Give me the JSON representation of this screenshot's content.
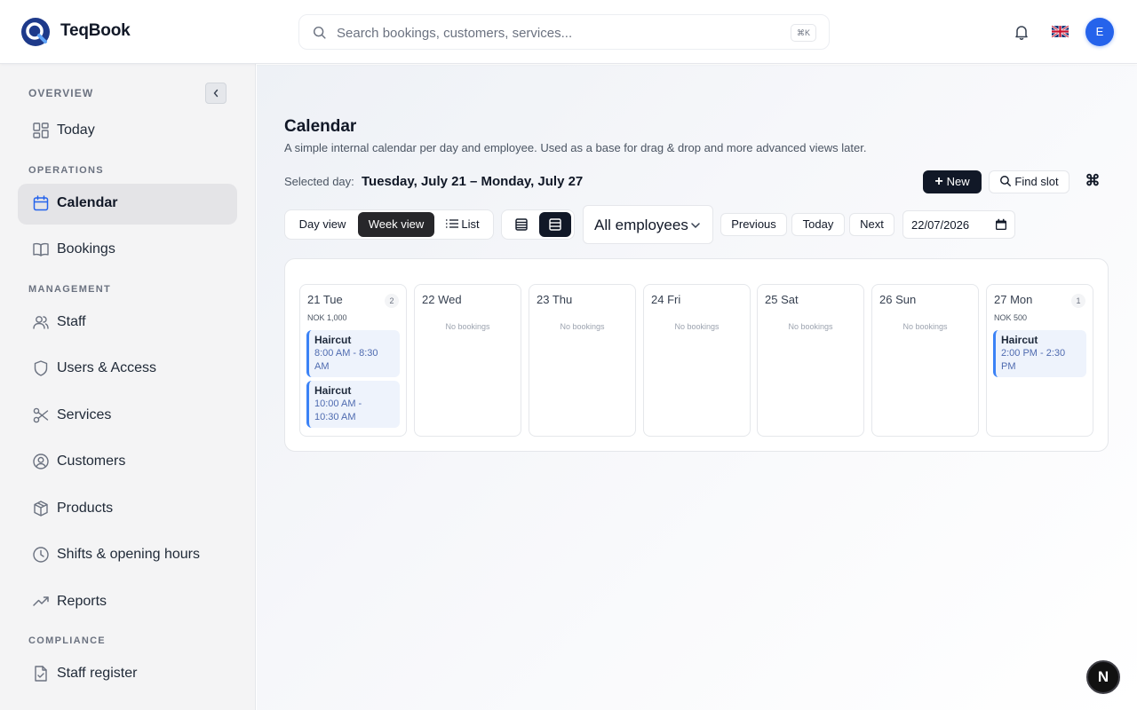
{
  "app": {
    "name": "TeqBook",
    "user_initial": "E"
  },
  "header": {
    "search_placeholder": "Search bookings, customers, services...",
    "search_shortcut": "⌘K"
  },
  "sidebar": {
    "sections": {
      "overview": "OVERVIEW",
      "operations": "OPERATIONS",
      "management": "MANAGEMENT",
      "compliance": "COMPLIANCE"
    },
    "items": [
      {
        "label": "Today",
        "icon": "grid-icon"
      },
      {
        "label": "Calendar",
        "icon": "calendar-icon",
        "active": true
      },
      {
        "label": "Bookings",
        "icon": "book-icon"
      },
      {
        "label": "Staff",
        "icon": "users-icon"
      },
      {
        "label": "Users & Access",
        "icon": "shield-icon"
      },
      {
        "label": "Services",
        "icon": "scissors-icon"
      },
      {
        "label": "Customers",
        "icon": "user-circle-icon"
      },
      {
        "label": "Products",
        "icon": "box-icon"
      },
      {
        "label": "Shifts & opening hours",
        "icon": "clock-icon"
      },
      {
        "label": "Reports",
        "icon": "trend-icon"
      },
      {
        "label": "Staff register",
        "icon": "file-check-icon"
      }
    ]
  },
  "main": {
    "title": "Calendar",
    "subtitle": "A simple internal calendar per day and employee. Used as a base for drag & drop and more advanced views later.",
    "selected_label": "Selected day:",
    "selected_value": "Tuesday, July 21 – Monday, July 27",
    "new_label": "New",
    "find_slot_label": "Find slot",
    "views": {
      "day": "Day view",
      "week": "Week view",
      "list": "List"
    },
    "employee_filter": "All employees",
    "nav": {
      "previous": "Previous",
      "today": "Today",
      "next": "Next"
    },
    "date_value": "22/07/2026",
    "empty_text": "No bookings",
    "days": [
      {
        "label": "21 Tue",
        "count": "2",
        "total": "NOK 1,000",
        "bookings": [
          {
            "title": "Haircut",
            "line1": "8:00 AM - 8:30",
            "line2": "AM"
          },
          {
            "title": "Haircut",
            "line1": "10:00 AM -",
            "line2": "10:30 AM"
          }
        ]
      },
      {
        "label": "22 Wed"
      },
      {
        "label": "23 Thu"
      },
      {
        "label": "24 Fri"
      },
      {
        "label": "25 Sat"
      },
      {
        "label": "26 Sun"
      },
      {
        "label": "27 Mon",
        "count": "1",
        "total": "NOK 500",
        "bookings": [
          {
            "title": "Haircut",
            "line1": "2:00 PM - 2:30",
            "line2": "PM"
          }
        ]
      }
    ]
  },
  "colors": {
    "accent": "#2563eb",
    "booking_border": "#3b82f6",
    "booking_bg": "#eef3fc",
    "dark": "#111827"
  },
  "dev_badge": "N"
}
